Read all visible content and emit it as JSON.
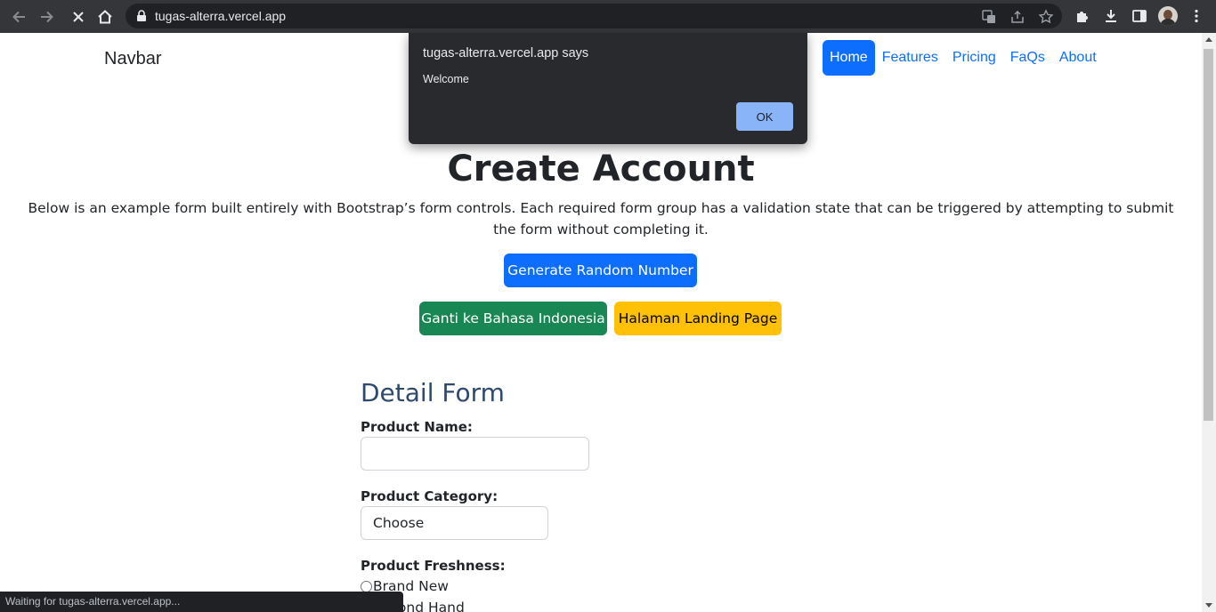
{
  "browser": {
    "url": "tugas-alterra.vercel.app",
    "status_text": "Waiting for tugas-alterra.vercel.app..."
  },
  "navbar": {
    "brand": "Navbar",
    "links": [
      "Home",
      "Features",
      "Pricing",
      "FaQs",
      "About"
    ],
    "active": "Home"
  },
  "hero": {
    "title": "Create Account",
    "description": "Below is an example form built entirely with Bootstrap’s form controls. Each required form group has a validation state that can be triggered by attempting to submit the form without completing it."
  },
  "buttons": {
    "generate": "Generate Random Number",
    "language": "Ganti ke Bahasa Indonesia",
    "landing": "Halaman Landing Page"
  },
  "form": {
    "title": "Detail Form",
    "product_name_label": "Product Name:",
    "product_name_value": "",
    "category_label": "Product Category:",
    "category_value": "Choose",
    "freshness_label": "Product Freshness:",
    "freshness_options": [
      "Brand New",
      "Second Hand"
    ]
  },
  "dialog": {
    "title": "tugas-alterra.vercel.app says",
    "message": "Welcome",
    "ok_label": "OK"
  },
  "colors": {
    "primary": "#0d6efd",
    "success": "#198754",
    "warning": "#ffc107",
    "form_title": "#2d4a6e",
    "dialog_bg": "#292a2d",
    "dialog_button": "#8ab4f8"
  }
}
